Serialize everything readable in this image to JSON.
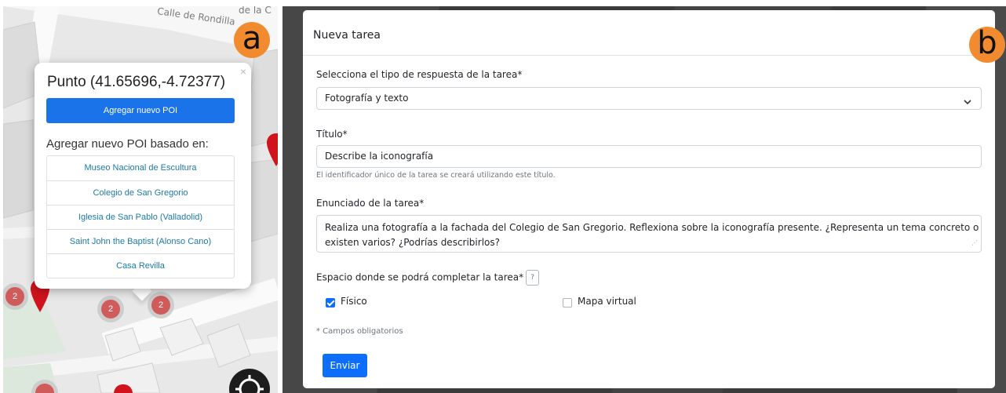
{
  "panel_a": {
    "badge": "a",
    "street_label_1": "Calle de Rondilla",
    "street_label_2": "de la C",
    "popup": {
      "close": "×",
      "title": "Punto (41.65696,-4.72377)",
      "add_button": "Agregar nuevo POI",
      "subtitle": "Agregar nuevo POI basado en:",
      "poi_options": [
        "Museo Nacional de Escultura",
        "Colegio de San Gregorio",
        "Iglesia de San Pablo (Valladolid)",
        "Saint John the Baptist (Alonso Cano)",
        "Casa Revilla"
      ]
    },
    "clusters": [
      "2",
      "2",
      "2"
    ],
    "marker_color": "#d0131c",
    "cluster_color": "#d05b5b"
  },
  "panel_b": {
    "badge": "b",
    "modal_title": "Nueva tarea",
    "response_type": {
      "label": "Selecciona el tipo de respuesta de la tarea*",
      "value": "Fotografía y texto"
    },
    "title_field": {
      "label": "Título*",
      "value": "Describe la iconografía",
      "help": "El identificador único de la tarea se creará utilizando este título."
    },
    "statement": {
      "label": "Enunciado de la tarea*",
      "line1": "Realiza una fotografía a la fachada del Colegio de San Gregorio. Reflexiona sobre la iconografía presente. ¿Representa un tema concreto o",
      "line2": "existen varios? ¿Podrías describirlos?"
    },
    "space": {
      "label": "Espacio donde se podrá completar la tarea*",
      "help_icon": "?",
      "option_physical": "Físico",
      "option_physical_checked": true,
      "option_virtual": "Mapa virtual",
      "option_virtual_checked": false
    },
    "required_note": "* Campos obligatorios",
    "submit_label": "Enviar"
  },
  "colors": {
    "primary": "#0d6efd",
    "popup_button": "#1a73e8",
    "badge": "#f28b30",
    "link": "#1c7aa8"
  }
}
